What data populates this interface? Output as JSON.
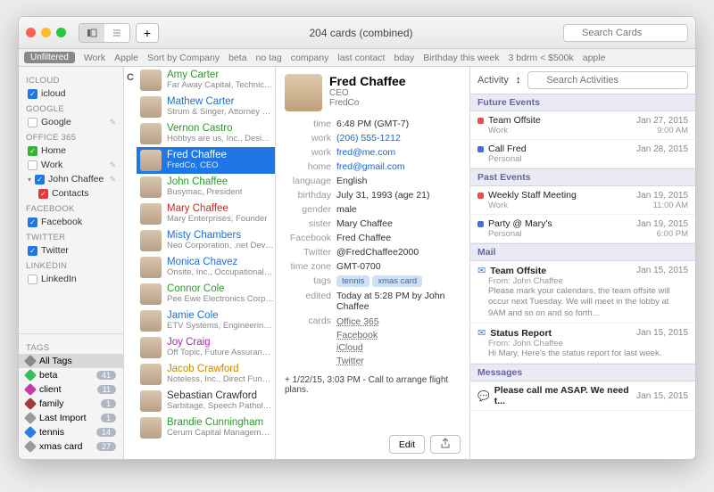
{
  "window_title": "204 cards (combined)",
  "search_placeholder": "Search Cards",
  "filters": [
    "Unfiltered",
    "Work",
    "Apple",
    "Sort by Company",
    "beta",
    "no tag",
    "company",
    "last contact",
    "bday",
    "Birthday this week",
    "3 bdrm < $500k",
    "apple"
  ],
  "sidebar": {
    "sections": [
      {
        "head": "ICLOUD",
        "items": [
          {
            "label": "icloud",
            "color": "#1f77e6",
            "checked": true,
            "edit": false
          }
        ]
      },
      {
        "head": "GOOGLE",
        "items": [
          {
            "label": "Google",
            "color": "#c9c9c9",
            "checked": false,
            "edit": true
          }
        ]
      },
      {
        "head": "OFFICE 365",
        "items": [
          {
            "label": "Home",
            "color": "#34b233",
            "checked": true,
            "edit": false
          },
          {
            "label": "Work",
            "color": "#d8a000",
            "checked": false,
            "edit": true
          },
          {
            "label": "John Chaffee",
            "color": "#1f77e6",
            "checked": true,
            "edit": true,
            "expanded": true
          },
          {
            "label": "Contacts",
            "color": "#e03a3a",
            "checked": true,
            "edit": false,
            "indent": true
          }
        ]
      },
      {
        "head": "FACEBOOK",
        "items": [
          {
            "label": "Facebook",
            "color": "#1f77e6",
            "checked": true,
            "edit": false
          }
        ]
      },
      {
        "head": "TWITTER",
        "items": [
          {
            "label": "Twitter",
            "color": "#1f77e6",
            "checked": true,
            "edit": false
          }
        ]
      },
      {
        "head": "LINKEDIN",
        "items": [
          {
            "label": "LinkedIn",
            "color": "#c9c9c9",
            "checked": false,
            "edit": false
          }
        ]
      }
    ],
    "tags_head": "TAGS",
    "tags": [
      {
        "label": "All Tags",
        "color": "#8a8a8a",
        "count": null,
        "sel": true
      },
      {
        "label": "beta",
        "color": "#33c060",
        "count": 41
      },
      {
        "label": "client",
        "color": "#c83aa8",
        "count": 11
      },
      {
        "label": "family",
        "color": "#a33a3a",
        "count": 1
      },
      {
        "label": "Last Import",
        "color": "#9a9a9a",
        "count": 1
      },
      {
        "label": "tennis",
        "color": "#2a7ee0",
        "count": 14
      },
      {
        "label": "xmas card",
        "color": "#9a9a9a",
        "count": 27
      }
    ]
  },
  "letter": "C",
  "contacts": [
    {
      "name": "Amy Carter",
      "sub": "Far Away Capital, Technician",
      "color": "#2a9a2a"
    },
    {
      "name": "Mathew Carter",
      "sub": "Strum & Singer, Attorney at Law",
      "color": "#1f6fd6"
    },
    {
      "name": "Vernon Castro",
      "sub": "Hobbys are us, Inc., Design En...",
      "color": "#2a9a2a"
    },
    {
      "name": "Fred Chaffee",
      "sub": "FredCo, CEO",
      "color": "#ffffff",
      "sel": true
    },
    {
      "name": "John Chaffee",
      "sub": "Busymac, President",
      "color": "#2a9a2a"
    },
    {
      "name": "Mary Chaffee",
      "sub": "Mary Enterprises, Founder",
      "color": "#c62a2a"
    },
    {
      "name": "Misty Chambers",
      "sub": "Neo Corporation, .net Developer",
      "color": "#1f6fd6"
    },
    {
      "name": "Monica Chavez",
      "sub": "Onsite, Inc., Occupational Ther...",
      "color": "#1f6fd6"
    },
    {
      "name": "Connor Cole",
      "sub": "Pee Ewe Electronics Corporati...",
      "color": "#2a9a2a"
    },
    {
      "name": "Jamie Cole",
      "sub": "ETV Systems, Engineering Ma...",
      "color": "#1f6fd6"
    },
    {
      "name": "Joy Craig",
      "sub": "Off Topic, Future Assurance Agent",
      "color": "#a82aa8"
    },
    {
      "name": "Jacob Crawford",
      "sub": "Noteless, Inc., Direct Functiona...",
      "color": "#c68a00"
    },
    {
      "name": "Sebastian Crawford",
      "sub": "Sarbitage, Speech Pathologist",
      "color": "#333"
    },
    {
      "name": "Brandie Cunningham",
      "sub": "Cerum Capital Management, S...",
      "color": "#2a9a2a"
    }
  ],
  "detail": {
    "name": "Fred Chaffee",
    "title": "CEO",
    "company": "FredCo",
    "rows": [
      {
        "label": "time",
        "val": "6:48 PM (GMT-7)"
      },
      {
        "label": "work",
        "val": "(206) 555-1212",
        "link": true
      },
      {
        "label": "work",
        "val": "fred@me.com",
        "link": true
      },
      {
        "label": "home",
        "val": "fred@gmail.com",
        "link": true
      },
      {
        "label": "language",
        "val": "English"
      },
      {
        "label": "birthday",
        "val": "July 31, 1993 (age 21)"
      },
      {
        "label": "gender",
        "val": "male"
      },
      {
        "label": "sister",
        "val": "Mary Chaffee"
      },
      {
        "label": "Facebook",
        "val": "Fred Chaffee"
      },
      {
        "label": "Twitter",
        "val": "@FredChaffee2000"
      },
      {
        "label": "time zone",
        "val": "GMT-0700"
      }
    ],
    "tags_label": "tags",
    "tags": [
      "tennis",
      "xmas card"
    ],
    "edited_label": "edited",
    "edited": "Today at 5:28 PM by John Chaffee",
    "cards_label": "cards",
    "cards": [
      "Office 365",
      "Facebook",
      "iCloud",
      "Twitter"
    ],
    "note": "+ 1/22/15, 3:03 PM - Call to arrange flight plans.",
    "edit_btn": "Edit"
  },
  "activity": {
    "label": "Activity",
    "search_placeholder": "Search Activities",
    "sections": [
      {
        "head": "Future Events",
        "items": [
          {
            "bullet": "#e05050",
            "title": "Team Offsite",
            "date": "Jan 27, 2015",
            "sub": "Work",
            "time": "9:00 AM"
          },
          {
            "bullet": "#4a6ad8",
            "title": "Call Fred",
            "date": "Jan 28, 2015",
            "sub": "Personal",
            "time": ""
          }
        ]
      },
      {
        "head": "Past Events",
        "items": [
          {
            "bullet": "#e05050",
            "title": "Weekly Staff Meeting",
            "date": "Jan 19, 2015",
            "sub": "Work",
            "time": "11:00 AM"
          },
          {
            "bullet": "#4a6ad8",
            "title": "Party @ Mary's",
            "date": "Jan 19, 2015",
            "sub": "Personal",
            "time": "6:00 PM"
          }
        ]
      },
      {
        "head": "Mail",
        "items": [
          {
            "icon": "mail",
            "title": "Team Offsite",
            "date": "Jan 15, 2015",
            "from": "From: John Chaffee",
            "body": "Please mark your calendars, the team offsite will occur next Tuesday. We will meet in the lobby at 9AM and so on and so forth..."
          },
          {
            "icon": "mail",
            "title": "Status Report",
            "date": "Jan 15, 2015",
            "from": "From: John Chaffee",
            "body": "Hi Mary,\n\nHere's the status report for last week."
          }
        ]
      },
      {
        "head": "Messages",
        "items": [
          {
            "icon": "msg",
            "title": "Please call me ASAP. We need t...",
            "date": "Jan 15, 2015",
            "from": "",
            "body": ""
          }
        ]
      }
    ]
  }
}
